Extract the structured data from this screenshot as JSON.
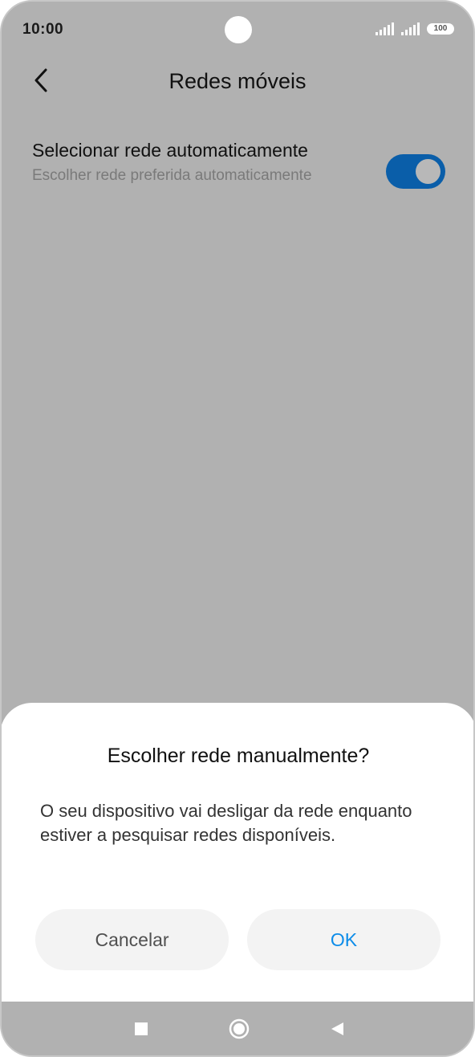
{
  "status_bar": {
    "time": "10:00",
    "battery": "100",
    "icons": [
      "signal-icon",
      "signal-icon",
      "battery-icon"
    ]
  },
  "header": {
    "title": "Redes móveis",
    "back_icon": "chevron-left-icon"
  },
  "setting": {
    "title": "Selecionar rede automaticamente",
    "subtitle": "Escolher rede preferida automaticamente",
    "toggle_on": true
  },
  "dialog": {
    "title": "Escolher rede manualmente?",
    "message": "O seu dispositivo vai desligar da rede enquanto estiver a pesquisar redes disponíveis.",
    "cancel_label": "Cancelar",
    "ok_label": "OK"
  },
  "nav_bar": {
    "icons": [
      "recents-square-icon",
      "home-circle-icon",
      "back-triangle-icon"
    ]
  },
  "colors": {
    "scrim_background": "#b1b1b1",
    "toggle_accent": "#0a5ea9",
    "ok_text": "#0c8ce9",
    "button_background": "#f3f3f3"
  }
}
